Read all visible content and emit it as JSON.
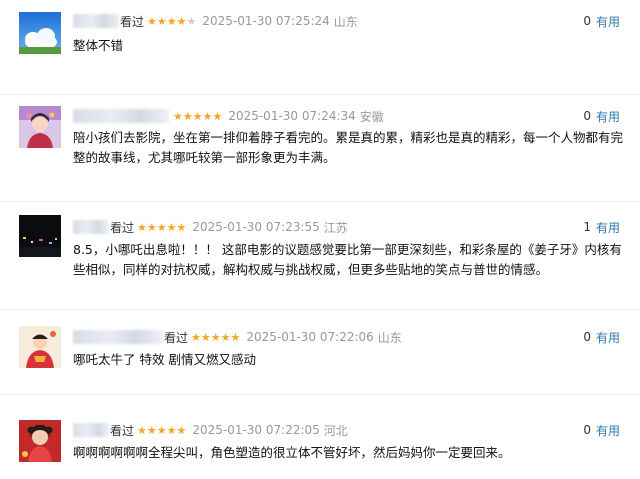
{
  "reviews": [
    {
      "seen_label": "看过",
      "rating": 4,
      "time": "2025-01-30 07:25:24",
      "location": "山东",
      "useful_count": "0",
      "useful_label": "有用",
      "content": "整体不错",
      "avatar_icon": "sky-cloud-avatar-icon"
    },
    {
      "seen_label": "",
      "rating": 5,
      "time": "2025-01-30 07:24:34",
      "location": "安徽",
      "useful_count": "0",
      "useful_label": "有用",
      "content": "陪小孩们去影院，坐在第一排仰着脖子看完的。累是真的累，精彩也是真的精彩，每一个人物都有完整的故事线，尤其哪吒较第一部形象更为丰满。",
      "avatar_icon": "anime-girl-avatar-icon"
    },
    {
      "seen_label": "看过",
      "rating": 5,
      "time": "2025-01-30 07:23:55",
      "location": "江苏",
      "useful_count": "1",
      "useful_label": "有用",
      "content": "8.5，小哪吒出息啦！！！ 这部电影的议题感觉要比第一部更深刻些，和彩条屋的《姜子牙》内核有些相似，同样的对抗权威，解构权威与挑战权威，但更多些贴地的笑点与普世的情感。",
      "avatar_icon": "night-scene-avatar-icon"
    },
    {
      "seen_label": "看过",
      "rating": 5,
      "time": "2025-01-30 07:22:06",
      "location": "山东",
      "useful_count": "0",
      "useful_label": "有用",
      "content": "哪吒太牛了 特效 剧情又燃又感动",
      "avatar_icon": "red-illustration-avatar-icon"
    },
    {
      "seen_label": "看过",
      "rating": 5,
      "time": "2025-01-30 07:22:05",
      "location": "河北",
      "useful_count": "0",
      "useful_label": "有用",
      "content": "啊啊啊啊啊啊全程尖叫，角色塑造的很立体不管好坏，然后妈妈你一定要回来。",
      "avatar_icon": "girl-portrait-avatar-icon"
    }
  ],
  "colors": {
    "star": "#f5a623",
    "star_off": "#cfcfcf",
    "useful_link": "#3377aa",
    "meta_gray": "#999999"
  }
}
